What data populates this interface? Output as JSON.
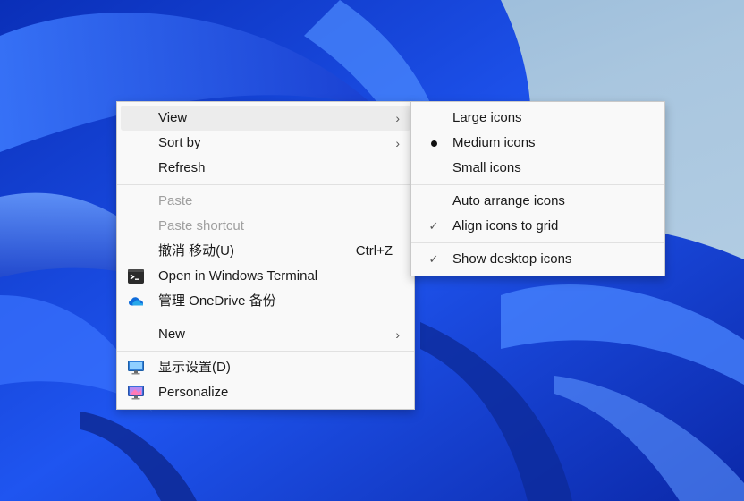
{
  "context_menu": {
    "items": {
      "view": "View",
      "sort_by": "Sort by",
      "refresh": "Refresh",
      "paste": "Paste",
      "paste_shortcut": "Paste shortcut",
      "undo": "撤消 移动(U)",
      "undo_shortcut": "Ctrl+Z",
      "open_terminal": "Open in Windows Terminal",
      "onedrive": "管理 OneDrive 备份",
      "new": "New",
      "display_settings": "显示设置(D)",
      "personalize": "Personalize"
    }
  },
  "view_submenu": {
    "items": {
      "large_icons": "Large icons",
      "medium_icons": "Medium icons",
      "small_icons": "Small icons",
      "auto_arrange": "Auto arrange icons",
      "align_grid": "Align icons to grid",
      "show_desktop_icons": "Show desktop icons"
    },
    "checkmark_glyph": "✓",
    "chevron_glyph": "›",
    "selected_size": "Medium icons"
  },
  "colors": {
    "wallpaper_blue": "#1f4fe0",
    "menu_background": "#f9f9f9",
    "hover_background": "#ececec",
    "disabled_text": "#a0a0a0"
  }
}
